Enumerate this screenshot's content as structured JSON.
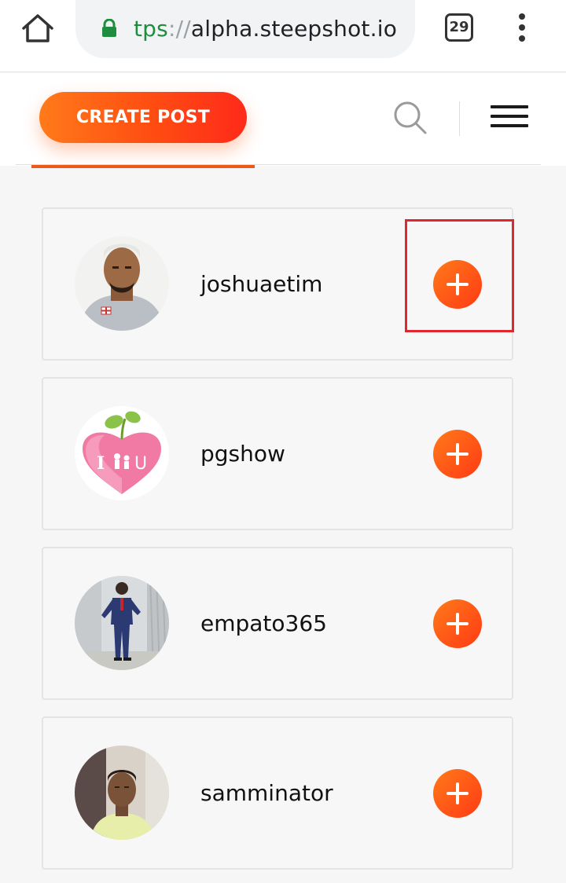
{
  "browser": {
    "url_scheme": "tps",
    "url_separator": "://",
    "url_host": "alpha.steepshot.io",
    "tab_count": "29",
    "icons": {
      "home": "home-icon",
      "lock": "lock-icon",
      "menu": "more-vert-icon"
    }
  },
  "header": {
    "create_post_label": "CREATE POST",
    "icons": {
      "search": "search-icon",
      "menu": "hamburger-menu-icon"
    }
  },
  "users": [
    {
      "username": "joshuaetim",
      "follow_icon": "plus-icon"
    },
    {
      "username": "pgshow",
      "follow_icon": "plus-icon"
    },
    {
      "username": "empato365",
      "follow_icon": "plus-icon"
    },
    {
      "username": "samminator",
      "follow_icon": "plus-icon"
    }
  ],
  "colors": {
    "accent_start": "#ff7a1a",
    "accent_end": "#ff3a14",
    "highlight": "#e0262e",
    "url_secure": "#1e8e3e"
  }
}
